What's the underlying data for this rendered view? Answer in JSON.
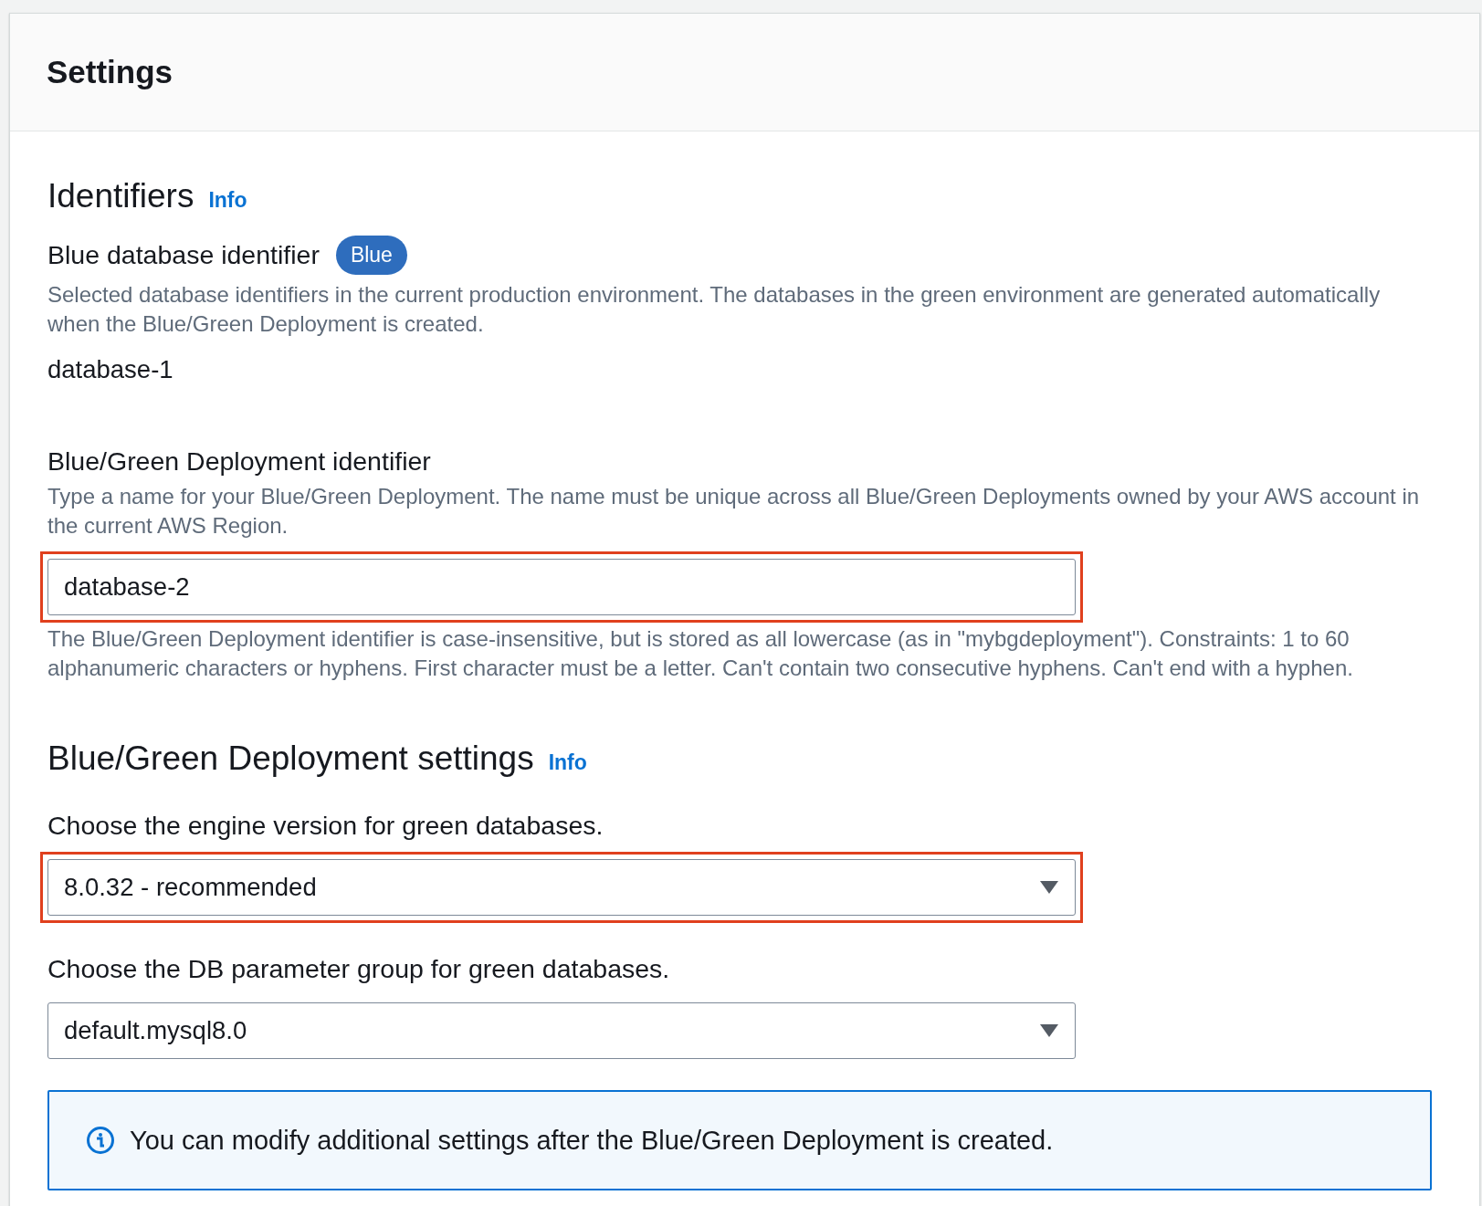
{
  "panel": {
    "title": "Settings"
  },
  "identifiers": {
    "heading": "Identifiers",
    "info_link": "Info",
    "blue_database_identifier": {
      "label": "Blue database identifier",
      "badge": "Blue",
      "description": "Selected database identifiers in the current production environment. The databases in the green environment are generated automatically when the Blue/Green Deployment is created.",
      "value": "database-1"
    },
    "deployment_identifier": {
      "label": "Blue/Green Deployment identifier",
      "description": "Type a name for your Blue/Green Deployment. The name must be unique across all Blue/Green Deployments owned by your AWS account in the current AWS Region.",
      "value": "database-2",
      "highlighted": true,
      "constraint": "The Blue/Green Deployment identifier is case-insensitive, but is stored as all lowercase (as in \"mybgdeployment\"). Constraints: 1 to 60 alphanumeric characters or hyphens. First character must be a letter. Can't contain two consecutive hyphens. Can't end with a hyphen."
    }
  },
  "deployment_settings": {
    "heading": "Blue/Green Deployment settings",
    "info_link": "Info",
    "fields": [
      {
        "label": "Choose the engine version for green databases.",
        "value": "8.0.32 - recommended",
        "highlighted": true
      },
      {
        "label": "Choose the DB parameter group for green databases.",
        "value": "default.mysql8.0",
        "highlighted": false
      }
    ],
    "alert": {
      "text": "You can modify additional settings after the Blue/Green Deployment is created."
    }
  }
}
